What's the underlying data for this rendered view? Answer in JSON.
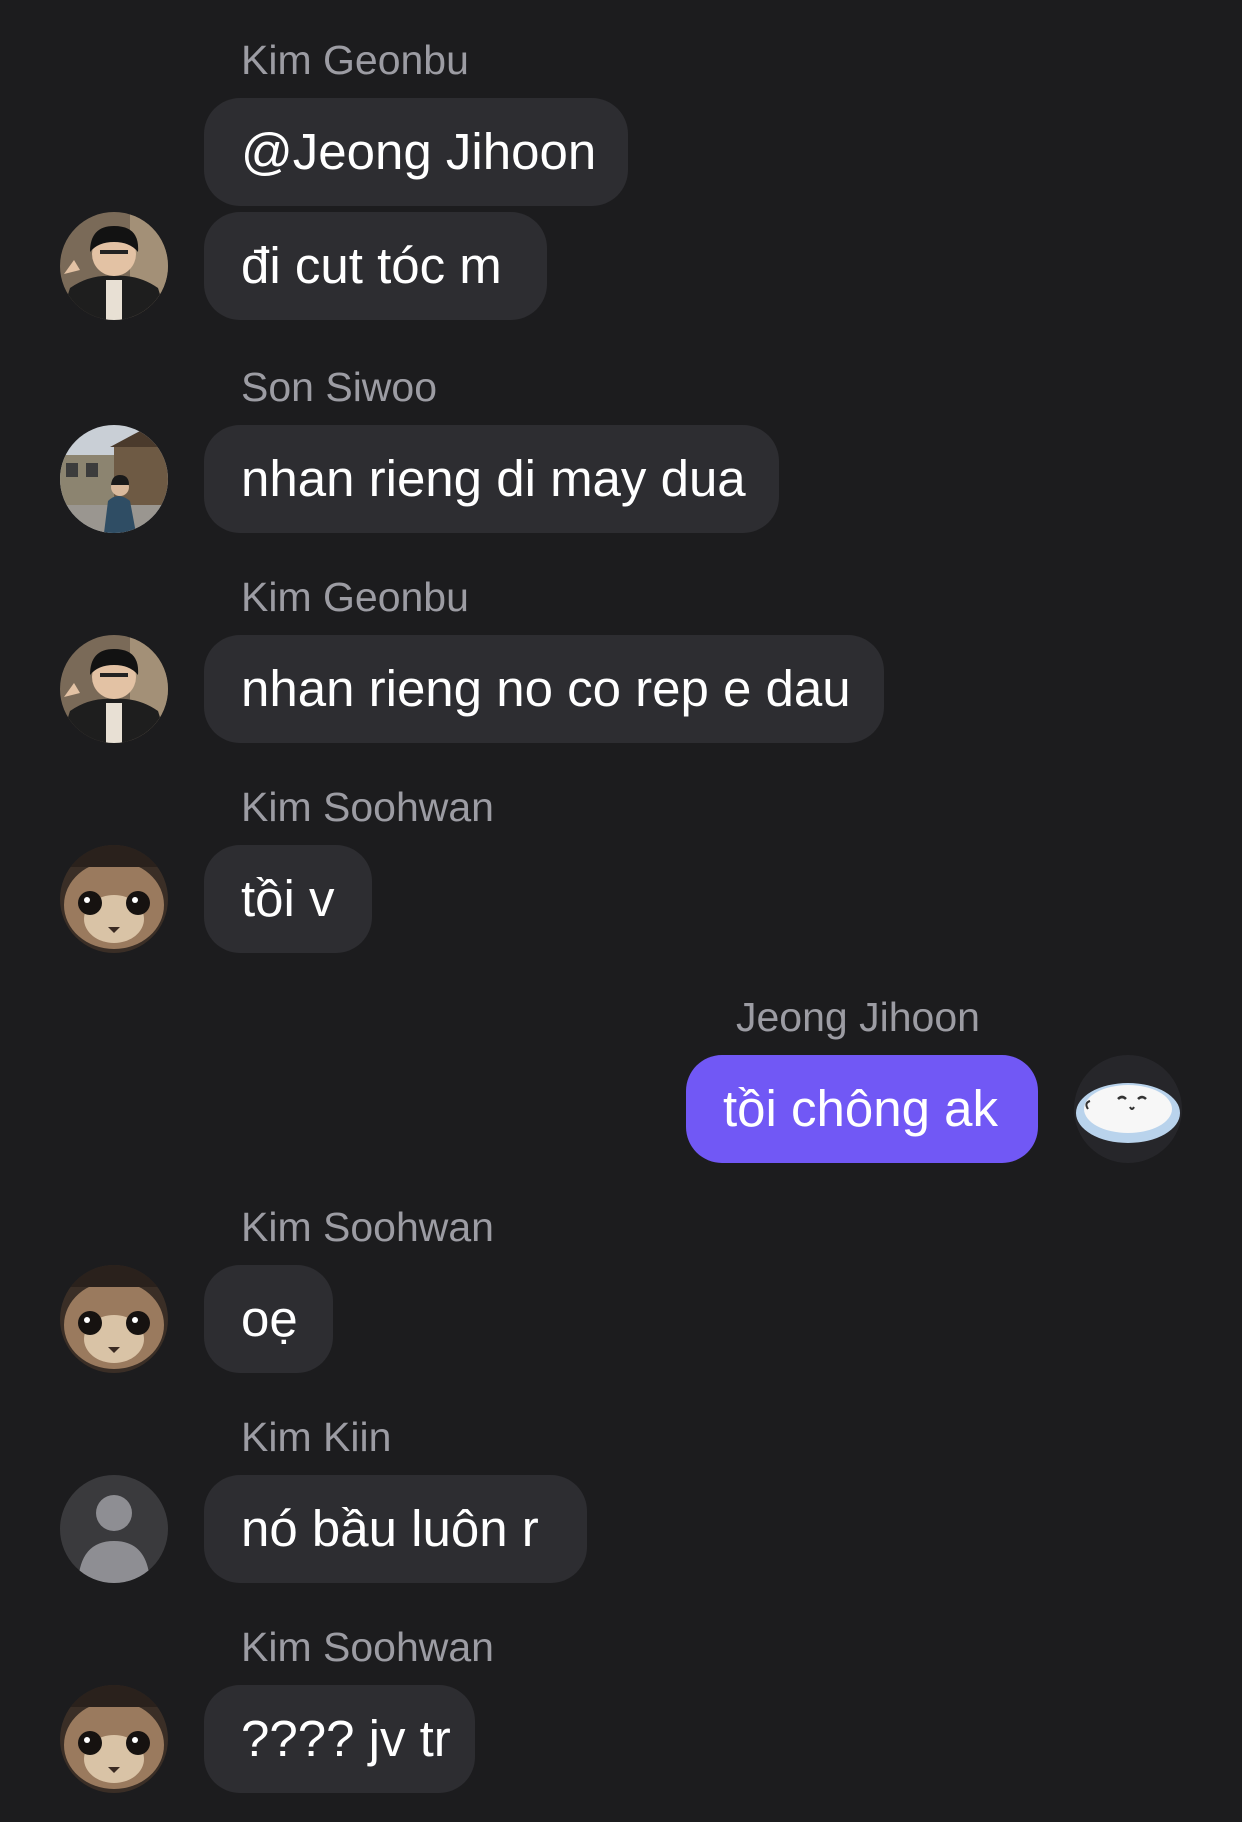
{
  "messages": [
    {
      "sender": "Kim Geonbu",
      "lines": [
        "@Jeong Jihoon",
        "đi cut tóc m"
      ],
      "avatar": "person-dark-jacket-avatar",
      "mine": false
    },
    {
      "sender": "Son Siwoo",
      "lines": [
        "nhan rieng di may dua"
      ],
      "avatar": "person-street-photo-avatar",
      "mine": false
    },
    {
      "sender": "Kim Geonbu",
      "lines": [
        "nhan rieng no co rep e dau"
      ],
      "avatar": "person-dark-jacket-avatar",
      "mine": false
    },
    {
      "sender": "Kim Soohwan",
      "lines": [
        "tồi v"
      ],
      "avatar": "cat-face-avatar",
      "mine": false
    },
    {
      "sender": "Jeong Jihoon",
      "lines": [
        "tồi chông ak"
      ],
      "avatar": "sleeping-blob-avatar",
      "mine": true
    },
    {
      "sender": "Kim Soohwan",
      "lines": [
        "oẹ"
      ],
      "avatar": "cat-face-avatar",
      "mine": false
    },
    {
      "sender": "Kim Kiin",
      "lines": [
        "nó bầu luôn r"
      ],
      "avatar": "default-user-avatar",
      "mine": false
    },
    {
      "sender": "Kim Soohwan",
      "lines": [
        "???? jv tr"
      ],
      "avatar": "cat-face-avatar",
      "mine": false
    }
  ],
  "colors": {
    "background": "#1c1c1e",
    "bubble": "#2d2d31",
    "bubble_mine": "#7158f5",
    "sender_name": "#9c9ca3",
    "text": "#ffffff"
  }
}
